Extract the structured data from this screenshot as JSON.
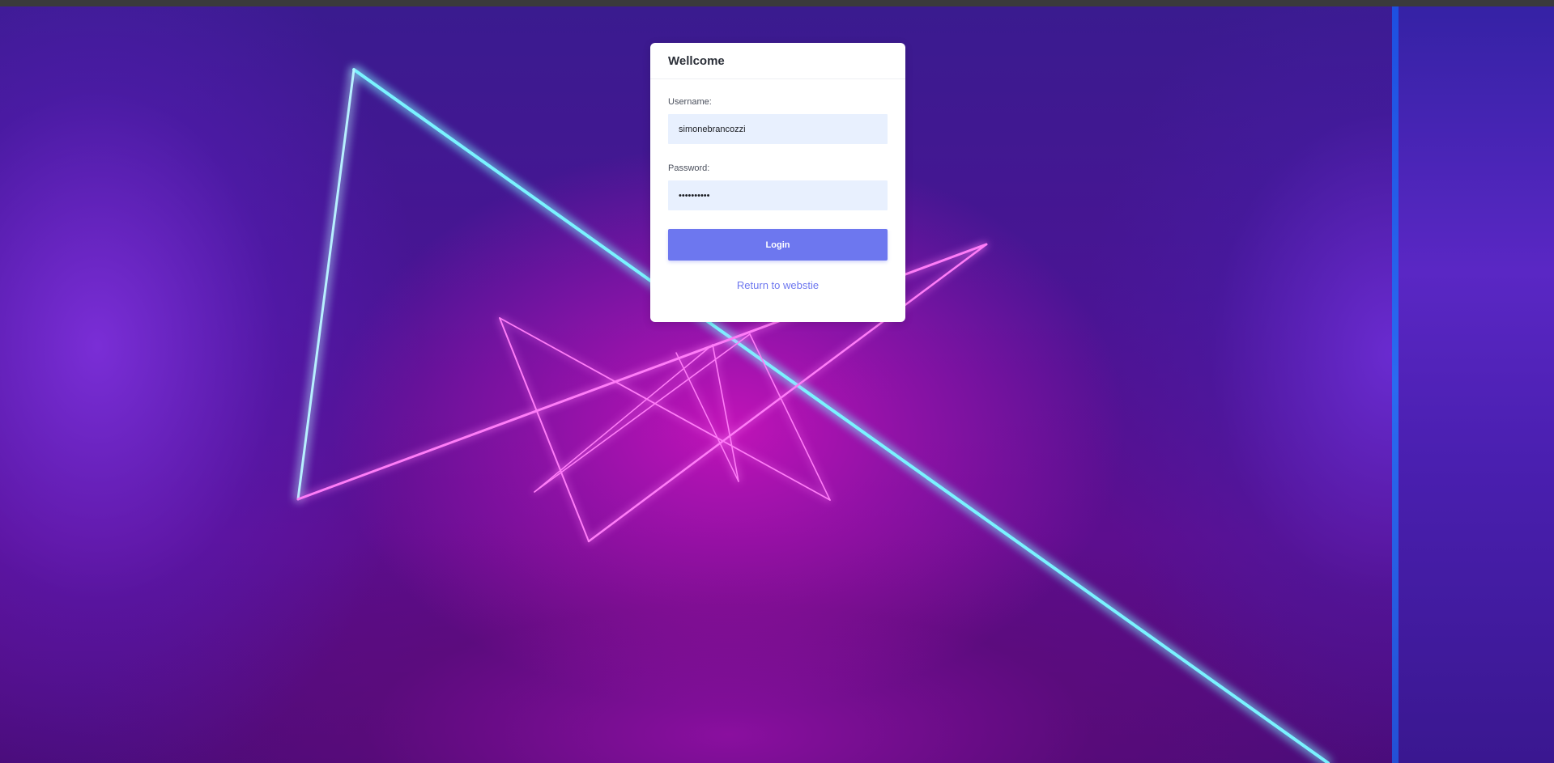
{
  "colors": {
    "accent": "#6d77ef",
    "input_background": "#e8f0fe",
    "card_background": "#ffffff",
    "title_text": "#2b2f38",
    "neon_cyan": "#5cf0ff",
    "neon_magenta": "#ff5cf5"
  },
  "background": {
    "icon": "neon-lines-background"
  },
  "login": {
    "title": "Wellcome",
    "username_label": "Username:",
    "username_value": "simonebrancozzi",
    "password_label": "Password:",
    "password_value": "••••••••••",
    "login_button": "Login",
    "return_link": "Return to webstie"
  }
}
